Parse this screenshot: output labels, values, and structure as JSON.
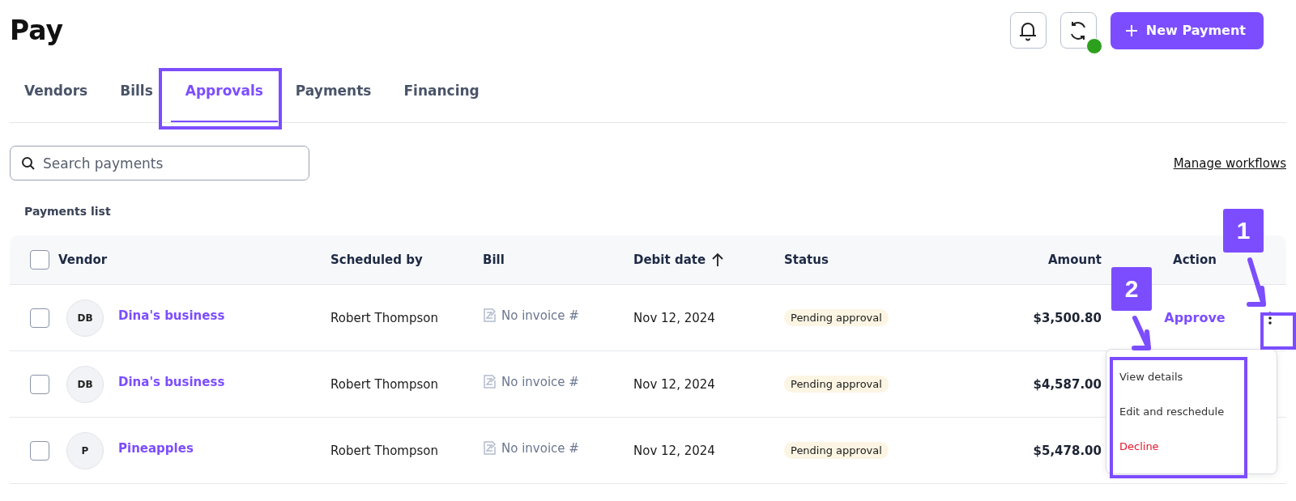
{
  "page": {
    "title": "Pay"
  },
  "header_actions": {
    "primary_button": "New Payment"
  },
  "tabs": [
    {
      "label": "Vendors",
      "selected": false
    },
    {
      "label": "Bills",
      "selected": false
    },
    {
      "label": "Approvals",
      "selected": true
    },
    {
      "label": "Payments",
      "selected": false
    },
    {
      "label": "Financing",
      "selected": false
    }
  ],
  "search": {
    "placeholder": "Search payments"
  },
  "manage_link": "Manage workflows",
  "list_title": "Payments list",
  "table": {
    "select_all": {
      "checked": false
    },
    "columns": [
      {
        "label": "Vendor",
        "sorted": false
      },
      {
        "label": "Scheduled by",
        "sorted": false
      },
      {
        "label": "Bill",
        "sorted": false
      },
      {
        "label": "Debit date",
        "sorted": true
      },
      {
        "label": "Status",
        "sorted": false
      },
      {
        "label": "Amount",
        "sorted": false
      },
      {
        "label": "Action",
        "sorted": false
      }
    ],
    "rows": [
      {
        "checked": false,
        "initials": "DB",
        "vendor": "Dina's business",
        "scheduled_by": "Robert Thompson",
        "bill": "No invoice #",
        "debit_date": "Nov 12, 2024",
        "status": "Pending approval",
        "amount": "$3,500.80",
        "action": "Approve"
      },
      {
        "checked": false,
        "initials": "DB",
        "vendor": "Dina's business",
        "scheduled_by": "Robert Thompson",
        "bill": "No invoice #",
        "debit_date": "Nov 12, 2024",
        "status": "Pending approval",
        "amount": "$4,587.00"
      },
      {
        "checked": false,
        "initials": "P",
        "vendor": "Pineapples",
        "scheduled_by": "Robert Thompson",
        "bill": "No invoice #",
        "debit_date": "Nov 12, 2024",
        "status": "Pending approval",
        "amount": "$5,478.00"
      }
    ]
  },
  "row_menu": {
    "items": [
      {
        "label": "View details",
        "kind": "normal"
      },
      {
        "label": "Edit and reschedule",
        "kind": "normal"
      },
      {
        "label": "Decline",
        "kind": "danger"
      }
    ]
  },
  "annotations": [
    {
      "label": "1"
    },
    {
      "label": "2"
    }
  ]
}
